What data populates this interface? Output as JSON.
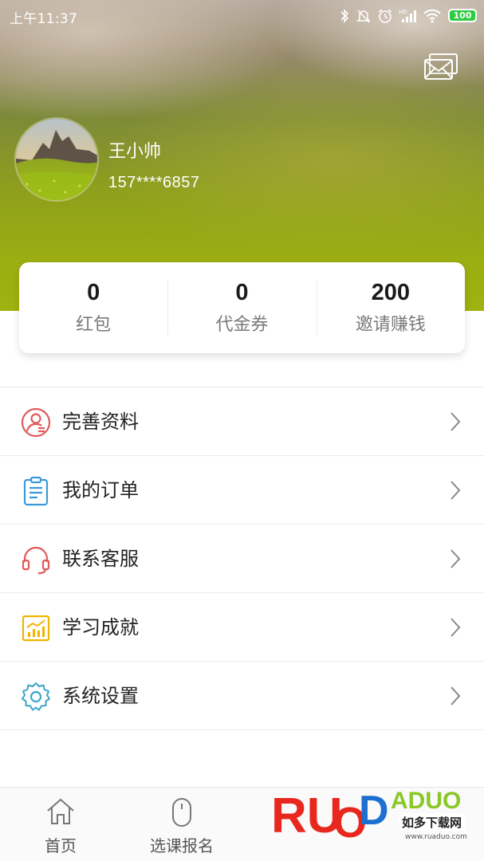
{
  "status_bar": {
    "time": "上午11:37",
    "battery": "100",
    "icons": [
      "bluetooth-icon",
      "mute-icon",
      "alarm-icon",
      "signal-icon",
      "wifi-icon",
      "battery-icon"
    ]
  },
  "header": {
    "message_icon": "envelope-icon"
  },
  "profile": {
    "name": "王小帅",
    "phone": "157****6857"
  },
  "stats": [
    {
      "value": "0",
      "label": "红包"
    },
    {
      "value": "0",
      "label": "代金券"
    },
    {
      "value": "200",
      "label": "邀请赚钱"
    }
  ],
  "menu": [
    {
      "label": "完善资料",
      "icon": "user-profile-icon",
      "color": "#e05a5a"
    },
    {
      "label": "我的订单",
      "icon": "clipboard-order-icon",
      "color": "#3a9ad9"
    },
    {
      "label": "联系客服",
      "icon": "headset-icon",
      "color": "#e05a5a"
    },
    {
      "label": "学习成就",
      "icon": "chart-achievement-icon",
      "color": "#f0b400"
    },
    {
      "label": "系统设置",
      "icon": "gear-icon",
      "color": "#3aa6c8"
    }
  ],
  "tabs": [
    {
      "label": "首页",
      "icon": "home-icon"
    },
    {
      "label": "选课报名",
      "icon": "mouse-icon"
    }
  ],
  "watermark": {
    "brand": "RUAODADUO",
    "cn": "如多下载网",
    "url": "www.ruaduo.com"
  },
  "colors": {
    "header_green": "#9aad12",
    "battery_green": "#2ecc40",
    "divider": "#ececec"
  }
}
